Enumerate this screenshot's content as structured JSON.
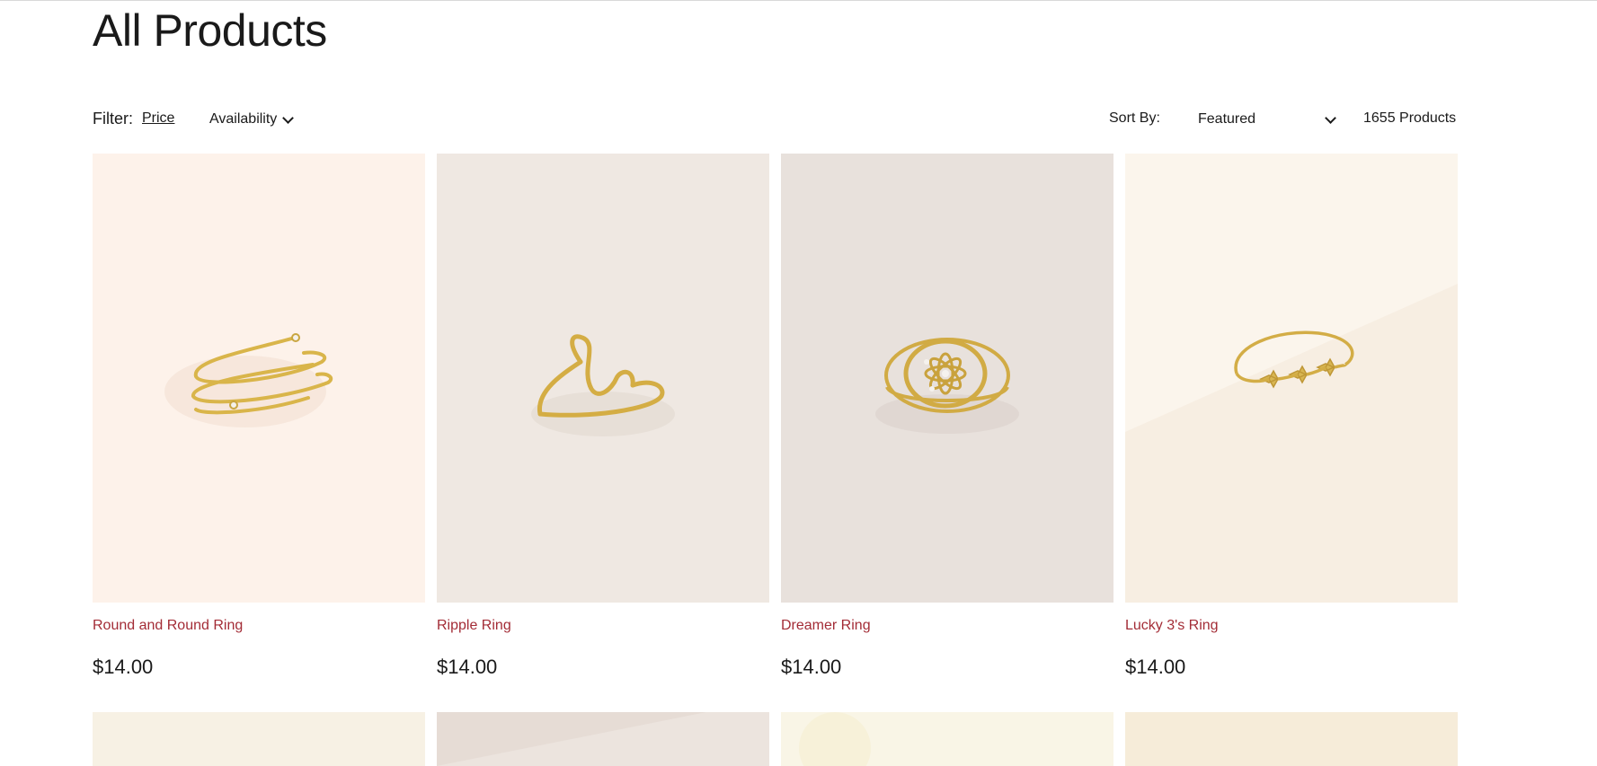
{
  "page": {
    "title": "All Products"
  },
  "filters": {
    "label": "Filter:",
    "price_label": "Price",
    "availability_label": "Availability",
    "sort_label": "Sort By:",
    "sort_selected": "Featured",
    "product_count": "1655 Products"
  },
  "products": [
    {
      "name": "Round and Round Ring",
      "price": "$14.00",
      "image": "spiral-ring-image",
      "bg": "#fdf2ea"
    },
    {
      "name": "Ripple Ring",
      "price": "$14.00",
      "image": "wave-ring-image",
      "bg": "#efe8e2"
    },
    {
      "name": "Dreamer Ring",
      "price": "$14.00",
      "image": "flower-signet-ring-image",
      "bg": "#e8e1dc"
    },
    {
      "name": "Lucky 3's Ring",
      "price": "$14.00",
      "image": "three-star-ring-image",
      "bg": "#fbf5ec"
    }
  ],
  "next_row_images": [
    {
      "image": "product-image-5",
      "bg": "#f7f1e4"
    },
    {
      "image": "product-image-6",
      "bg": "#e6dcd5"
    },
    {
      "image": "product-image-7",
      "bg": "#f9f5e6"
    },
    {
      "image": "product-image-8",
      "bg": "#f6ecd9"
    }
  ],
  "colors": {
    "product_name": "#a32c36",
    "text": "#1a1a1a",
    "ring_gold": "#d9b54a"
  }
}
